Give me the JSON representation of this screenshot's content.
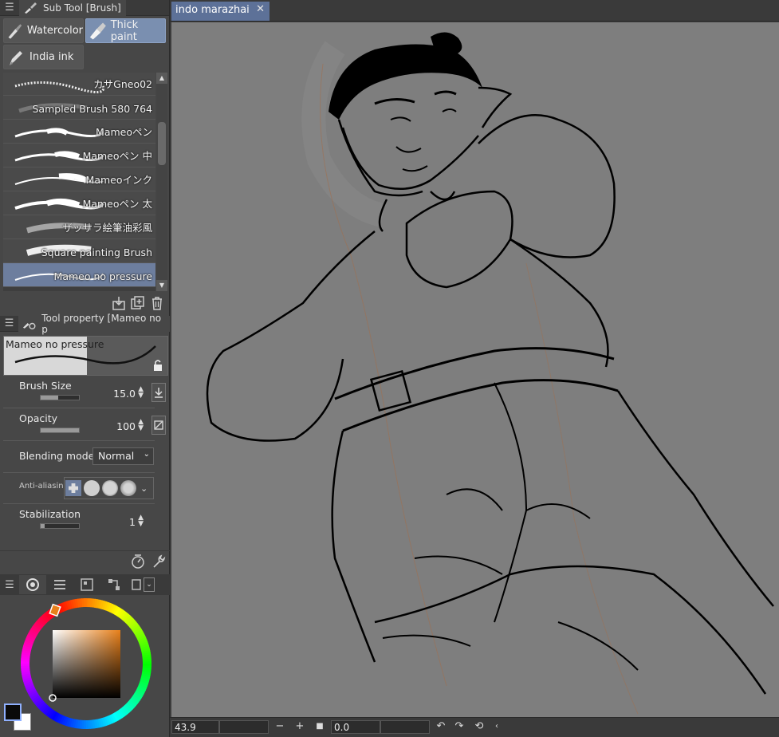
{
  "subtool_panel": {
    "title": "Sub Tool [Brush]",
    "groups": [
      {
        "label": "Watercolor",
        "active": false
      },
      {
        "label": "Thick paint",
        "active": true
      },
      {
        "label": "India ink",
        "active": false
      }
    ],
    "brushes": [
      {
        "name": "カサGneo02"
      },
      {
        "name": "Sampled Brush 580 764"
      },
      {
        "name": "Mameoペン"
      },
      {
        "name": "Mameoペン 中"
      },
      {
        "name": "Mameoインク"
      },
      {
        "name": "Mameoペン 太"
      },
      {
        "name": "ザッサラ絵筆油彩風"
      },
      {
        "name": "Square painting Brush"
      },
      {
        "name": "Mameo no pressure",
        "selected": true
      }
    ]
  },
  "tool_property": {
    "title": "Tool property [Mameo no p",
    "brush_name": "Mameo no pressure",
    "brush_size": {
      "label": "Brush Size",
      "value": "15.0",
      "level": 0.45
    },
    "opacity": {
      "label": "Opacity",
      "value": "100",
      "level": 1.0
    },
    "blending_mode": {
      "label": "Blending mode",
      "value": "Normal"
    },
    "anti_aliasing": {
      "label": "Anti-aliasing"
    },
    "stabilization": {
      "label": "Stabilization",
      "value": "1",
      "level": 0.1
    }
  },
  "color_panel": {
    "main_color": "#0a0a0a",
    "sub_color": "#ffffff",
    "hue_color": "#e8801a"
  },
  "document": {
    "tab_label": "indo marazhai",
    "close_glyph": "✕"
  },
  "statusbar": {
    "zoom": "43.9",
    "rotation": "0.0",
    "minus": "−",
    "plus": "+"
  }
}
